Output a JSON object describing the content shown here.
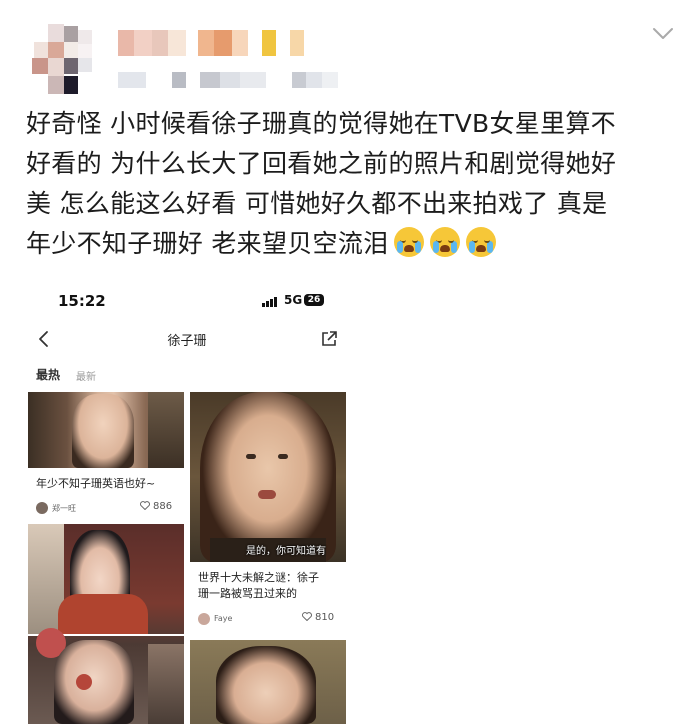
{
  "post": {
    "text_line1": "好奇怪 小时候看徐子珊真的觉得她在TVB女星里算不",
    "text_line2": "好看的 为什么长大了回看她之前的照片和剧觉得她好",
    "text_line3": "美 怎么能这么好看 可惜她好久都不出来拍戏了 真是",
    "text_line4": "年少不知子珊好 老来望贝空流泪",
    "emoji_names": [
      "crying-face-icon",
      "crying-face-icon",
      "crying-face-icon"
    ]
  },
  "screenshot": {
    "status_time": "15:22",
    "network": "5G",
    "battery": "26",
    "nav_title": "徐子珊",
    "tab_hot": "最热",
    "tab_new": "最新",
    "cards": [
      {
        "title": "年少不知子珊英语也好~",
        "user": "郑一旺",
        "likes": "886"
      },
      {
        "title": "世界十大未解之谜：徐子珊一路被骂丑过来的",
        "title_line1": "世界十大未解之谜：徐子",
        "title_line2": "珊一路被骂丑过来的",
        "user": "Faye",
        "likes": "810",
        "subtitle": "是的，你可知道有"
      }
    ]
  },
  "colors": {
    "text": "#1c1c1c",
    "emoji_yellow": "#f6c738",
    "tear_blue": "#5bb7f0"
  }
}
